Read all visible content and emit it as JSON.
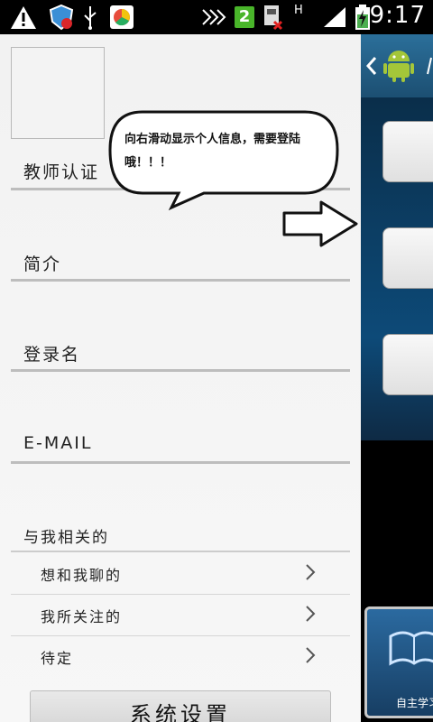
{
  "status_bar": {
    "time": "9:17",
    "network_type": "H",
    "badge": "2",
    "icons": [
      "warning-icon",
      "security-shield-icon",
      "usb-icon",
      "app-icon",
      "signal-missed-icon",
      "sim-off-icon",
      "cell-signal-icon",
      "battery-charging-icon"
    ]
  },
  "drawer": {
    "fields": [
      {
        "label": "教师认证"
      },
      {
        "label": "简介"
      },
      {
        "label": "登录名"
      },
      {
        "label": "E-MAIL"
      }
    ],
    "section_title": "与我相关的",
    "menu": [
      {
        "label": "想和我聊的"
      },
      {
        "label": "我所关注的"
      },
      {
        "label": "待定"
      }
    ],
    "settings_button": "系统设置"
  },
  "annotation": {
    "text": "向右滑动显示个人信息，需要登陆哦！！！"
  },
  "peek_panel": {
    "tile_label": "自主学习"
  },
  "colors": {
    "drawer_bg": "#f2f2f2",
    "divider": "#bdbdbd",
    "peek_header": "#2b6f9a"
  }
}
